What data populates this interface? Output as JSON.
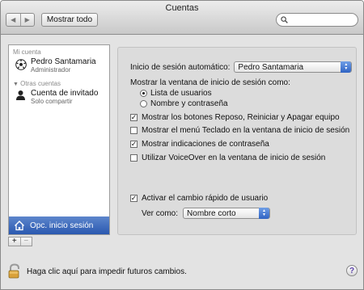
{
  "window": {
    "title": "Cuentas",
    "nav": {
      "back": "◀",
      "forward": "▶"
    },
    "show_all": "Mostrar todo",
    "search": {
      "value": ""
    }
  },
  "sidebar": {
    "my_account_header": "Mi cuenta",
    "my_account": {
      "name": "Pedro Santamaria",
      "role": "Administrador"
    },
    "other_header": "Otras cuentas",
    "others": [
      {
        "name": "Cuenta de invitado",
        "role": "Solo compartir"
      }
    ],
    "login_options": "Opc. inicio sesión",
    "add": "+",
    "remove": "−"
  },
  "settings": {
    "auto_login_label": "Inicio de sesión automático:",
    "auto_login_value": "Pedro Santamaria",
    "show_window_label": "Mostrar la ventana de inicio de sesión como:",
    "radio_list": "Lista de usuarios",
    "radio_list_selected": true,
    "radio_name": "Nombre y contraseña",
    "checks": [
      {
        "label": "Mostrar los botones Reposo, Reiniciar y Apagar equipo",
        "checked": true
      },
      {
        "label": "Mostrar el menú Teclado en la ventana de inicio de sesión",
        "checked": false
      },
      {
        "label": "Mostrar indicaciones de contraseña",
        "checked": true
      },
      {
        "label": "Utilizar VoiceOver en la ventana de inicio de sesión",
        "checked": false
      }
    ],
    "fast_switch": {
      "label": "Activar el cambio rápido de usuario",
      "checked": true
    },
    "view_as_label": "Ver como:",
    "view_as_value": "Nombre corto"
  },
  "footer": {
    "lock_text": "Haga clic aquí para impedir futuros cambios.",
    "help": "?"
  }
}
